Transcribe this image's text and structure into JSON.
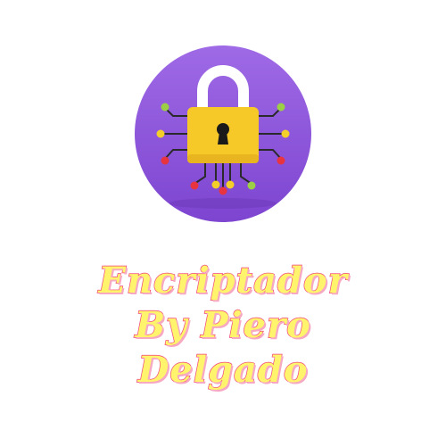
{
  "logo": {
    "name": "padlock-circuit-logo",
    "colors": {
      "circle": "#8a52d9",
      "circle_light": "#9d68e6",
      "shackle": "#ffffff",
      "lock_body": "#f7c928",
      "keyhole": "#1a1a1a",
      "wires": "#2a2a2a",
      "dot_green": "#9ccf45",
      "dot_yellow": "#f4cf2a",
      "dot_red": "#e8343f"
    }
  },
  "title": {
    "lines": [
      "Encriptador",
      "By Piero",
      "Delgado"
    ],
    "fill_color": "#fff46b",
    "outline_color": "#f0407a"
  }
}
